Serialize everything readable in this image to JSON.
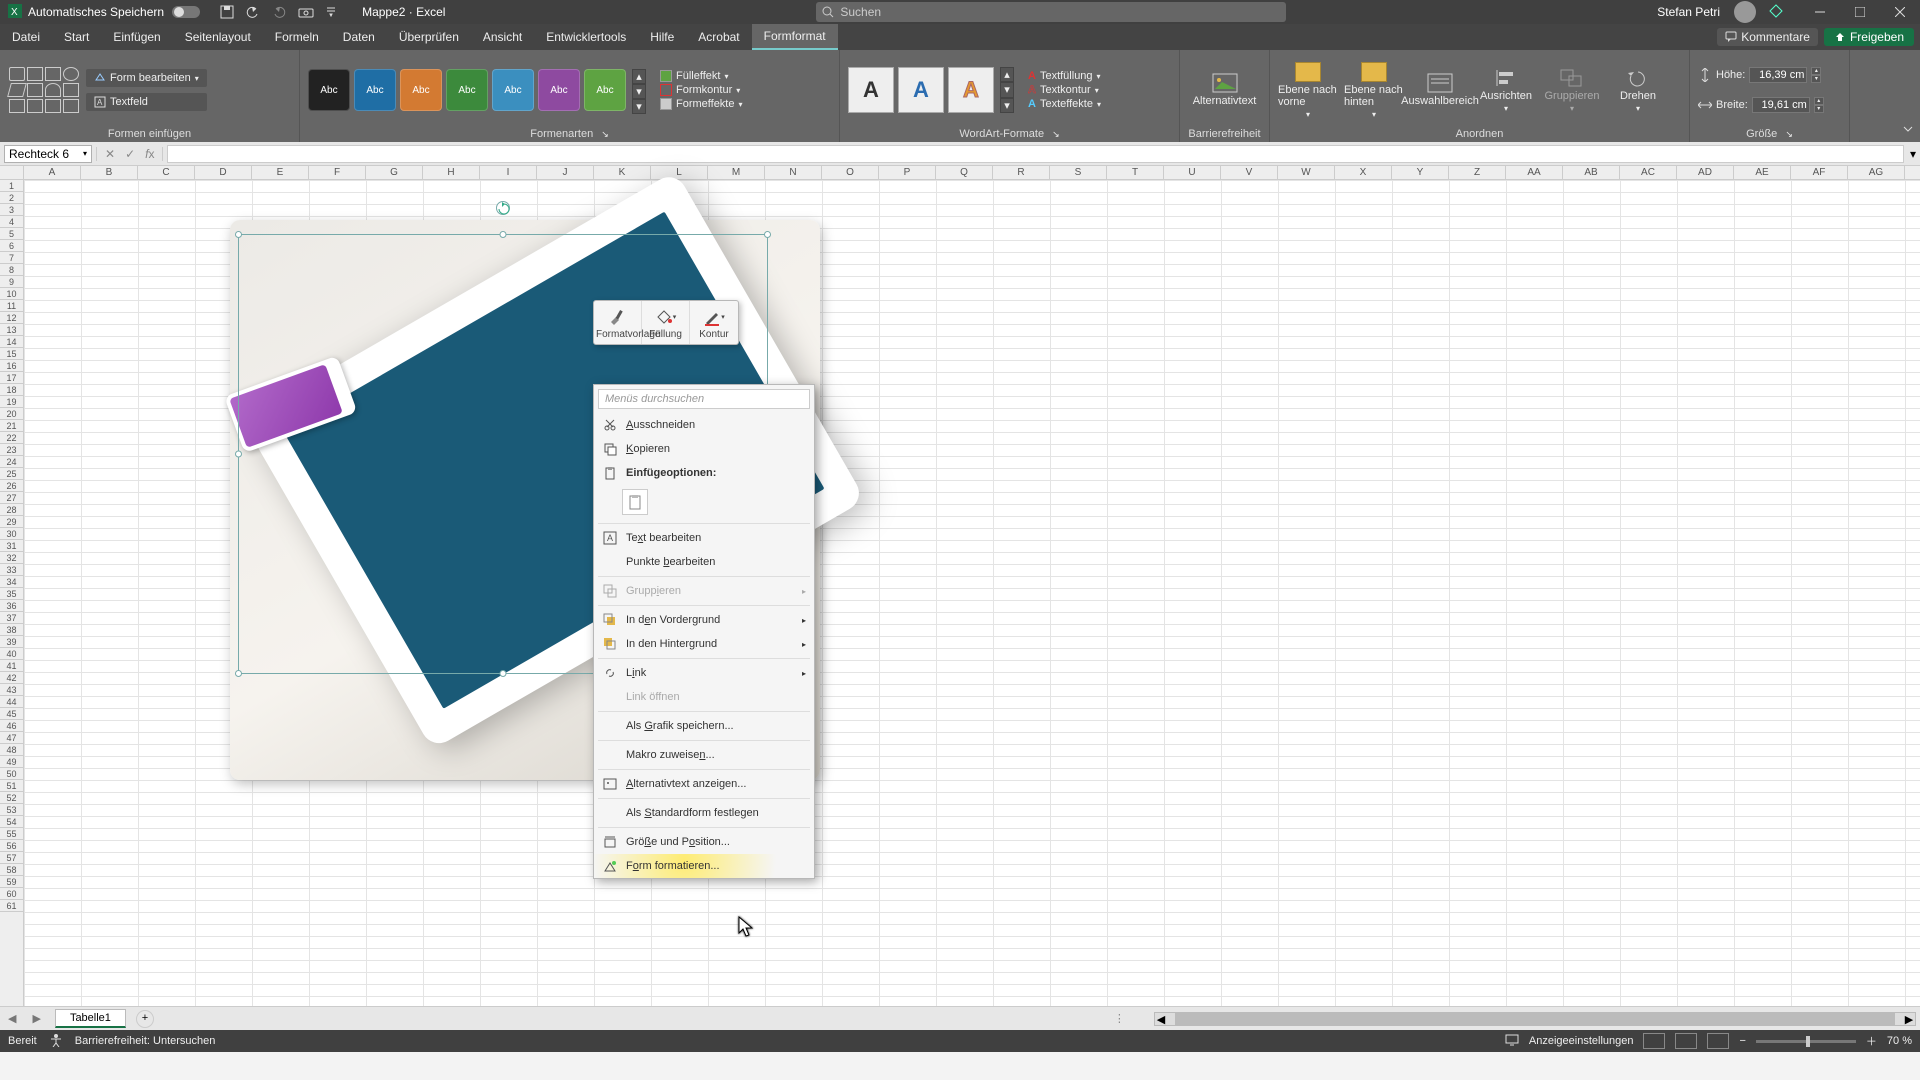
{
  "title": {
    "autosave": "Automatisches Speichern",
    "docname": "Mappe2",
    "appname": "Excel",
    "search_placeholder": "Suchen",
    "user": "Stefan Petri"
  },
  "tabs": {
    "items": [
      "Datei",
      "Start",
      "Einfügen",
      "Seitenlayout",
      "Formeln",
      "Daten",
      "Überprüfen",
      "Ansicht",
      "Entwicklertools",
      "Hilfe",
      "Acrobat",
      "Formformat"
    ],
    "active_index": 11,
    "kommentare": "Kommentare",
    "freigeben": "Freigeben"
  },
  "ribbon": {
    "formen_einfuegen": {
      "form_bearbeiten": "Form bearbeiten",
      "textfeld": "Textfeld",
      "label": "Formen einfügen"
    },
    "formenarten": {
      "label": "Formenarten",
      "items_text": "Abc",
      "colors": [
        "#222222",
        "#1f6ea5",
        "#d37a32",
        "#3c8a3c",
        "#3b8fbf",
        "#8e4aa0",
        "#5ea342"
      ],
      "fuelleffekt": "Fülleffekt",
      "formkontur": "Formkontur",
      "formeffekte": "Formeffekte"
    },
    "wordart": {
      "label": "WordArt-Formate",
      "textfuellung": "Textfüllung",
      "textkontur": "Textkontur",
      "texteffekte": "Texteffekte"
    },
    "barrierefreiheit": {
      "btn": "Alternativtext",
      "label": "Barrierefreiheit"
    },
    "anordnen": {
      "ebene_vorne": "Ebene nach vorne",
      "ebene_hinten": "Ebene nach hinten",
      "auswahlbereich": "Auswahlbereich",
      "ausrichten": "Ausrichten",
      "gruppieren": "Gruppieren",
      "drehen": "Drehen",
      "label": "Anordnen"
    },
    "groesse": {
      "label": "Größe",
      "hoehe_label": "Höhe:",
      "hoehe": "16,39 cm",
      "breite_label": "Breite:",
      "breite": "19,61 cm"
    }
  },
  "namebox": "Rechteck 6",
  "col_letters": [
    "A",
    "B",
    "C",
    "D",
    "E",
    "F",
    "G",
    "H",
    "I",
    "J",
    "K",
    "L",
    "M",
    "N",
    "O",
    "P",
    "Q",
    "R",
    "S",
    "T",
    "U",
    "V",
    "W",
    "X",
    "Y",
    "Z",
    "AA",
    "AB",
    "AC",
    "AD",
    "AE",
    "AF",
    "AG"
  ],
  "mini_toolbar": {
    "formatvorlage": "Formatvorlage",
    "fuellung": "Füllung",
    "kontur": "Kontur"
  },
  "context_menu": {
    "search": "Menüs durchsuchen",
    "ausschneiden": "Ausschneiden",
    "kopieren": "Kopieren",
    "einfuegeoptionen": "Einfügeoptionen:",
    "text_bearbeiten": "Text bearbeiten",
    "punkte_bearbeiten": "Punkte bearbeiten",
    "gruppieren": "Gruppieren",
    "vordergrund": "In den Vordergrund",
    "hintergrund": "In den Hintergrund",
    "link": "Link",
    "link_oeffnen": "Link öffnen",
    "grafik_speichern": "Als Grafik speichern...",
    "makro_zuweisen": "Makro zuweisen...",
    "alttext": "Alternativtext anzeigen...",
    "standardform": "Als Standardform festlegen",
    "groesse_position": "Größe und Position...",
    "form_formatieren": "Form formatieren..."
  },
  "sheet": {
    "tab1": "Tabelle1"
  },
  "status": {
    "bereit": "Bereit",
    "barrierefreiheit": "Barrierefreiheit: Untersuchen",
    "anzeige": "Anzeigeeinstellungen",
    "zoom": "70 %"
  }
}
